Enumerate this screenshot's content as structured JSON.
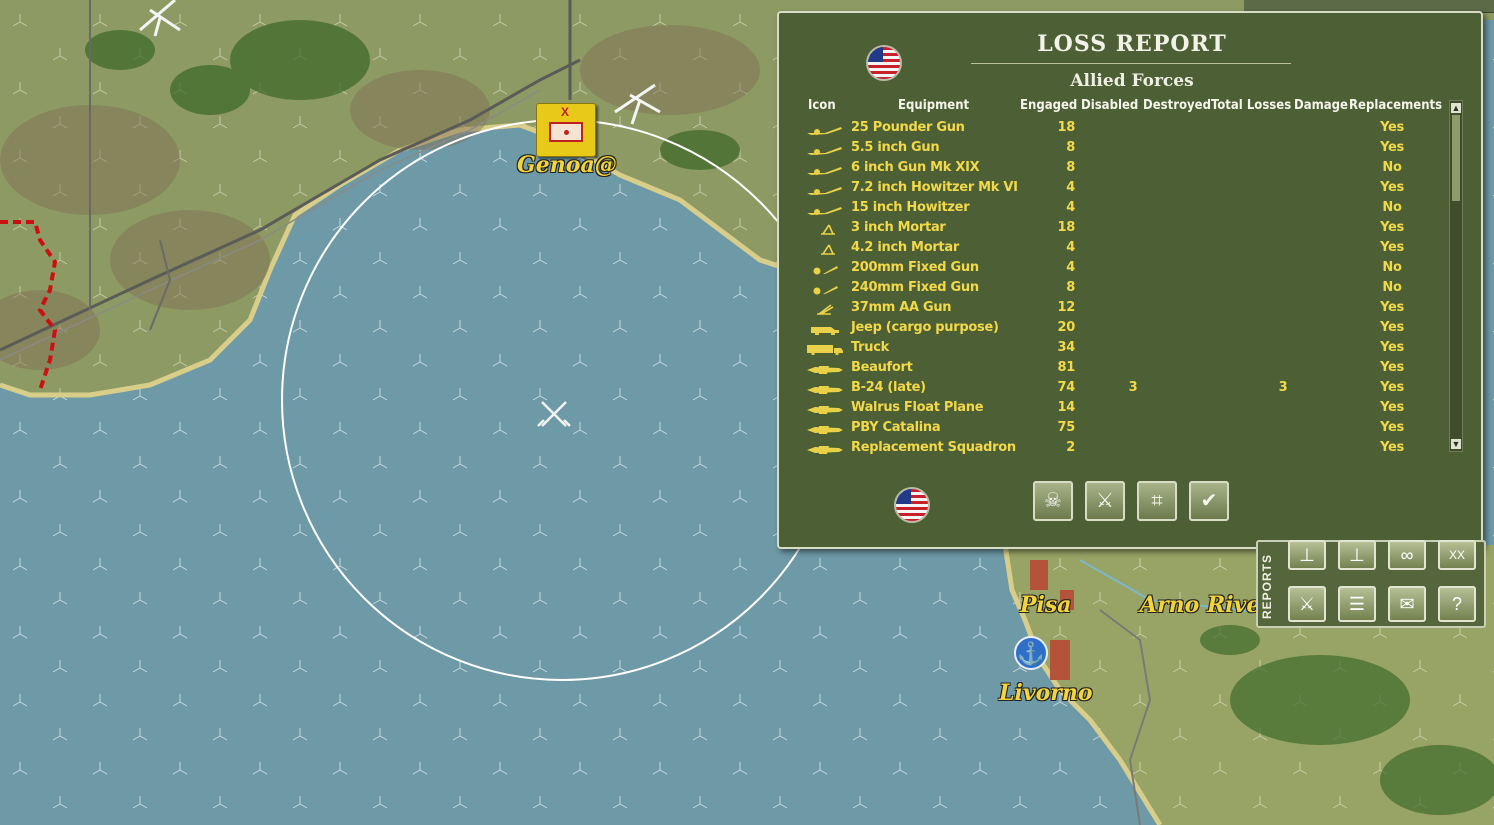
{
  "map": {
    "cities": {
      "genoa": "Genoa@",
      "pisa": "Pisa",
      "arno_river": "Arno Rive",
      "livorno": "Livorno"
    },
    "unit_counter_symbol": "X",
    "icons": [
      "airfield-icon",
      "port-anchor-icon",
      "battle-crossed-swords-icon"
    ]
  },
  "loss_report": {
    "title": "LOSS REPORT",
    "side": "Allied Forces",
    "columns": [
      "Icon",
      "Equipment",
      "Engaged",
      "Disabled",
      "Destroyed",
      "Total Losses",
      "Damage",
      "Replacements"
    ],
    "rows": [
      {
        "icon": "artillery-icon",
        "equipment": "25 Pounder Gun",
        "engaged": "18",
        "disabled": "",
        "total": "",
        "replacements": "Yes"
      },
      {
        "icon": "artillery-icon",
        "equipment": "5.5 inch Gun",
        "engaged": "8",
        "disabled": "",
        "total": "",
        "replacements": "Yes"
      },
      {
        "icon": "artillery-icon",
        "equipment": "6 inch Gun Mk XIX",
        "engaged": "8",
        "disabled": "",
        "total": "",
        "replacements": "No"
      },
      {
        "icon": "artillery-icon",
        "equipment": "7.2 inch Howitzer Mk VI",
        "engaged": "4",
        "disabled": "",
        "total": "",
        "replacements": "Yes"
      },
      {
        "icon": "artillery-icon",
        "equipment": "15 inch Howitzer",
        "engaged": "4",
        "disabled": "",
        "total": "",
        "replacements": "No"
      },
      {
        "icon": "mortar-icon",
        "equipment": "3 inch Mortar",
        "engaged": "18",
        "disabled": "",
        "total": "",
        "replacements": "Yes"
      },
      {
        "icon": "mortar-icon",
        "equipment": "4.2 inch Mortar",
        "engaged": "4",
        "disabled": "",
        "total": "",
        "replacements": "Yes"
      },
      {
        "icon": "fixed-gun-icon",
        "equipment": "200mm Fixed Gun",
        "engaged": "4",
        "disabled": "",
        "total": "",
        "replacements": "No"
      },
      {
        "icon": "fixed-gun-icon",
        "equipment": "240mm Fixed Gun",
        "engaged": "8",
        "disabled": "",
        "total": "",
        "replacements": "No"
      },
      {
        "icon": "aa-gun-icon",
        "equipment": "37mm AA Gun",
        "engaged": "12",
        "disabled": "",
        "total": "",
        "replacements": "Yes"
      },
      {
        "icon": "jeep-icon",
        "equipment": "Jeep (cargo purpose)",
        "engaged": "20",
        "disabled": "",
        "total": "",
        "replacements": "Yes"
      },
      {
        "icon": "truck-icon",
        "equipment": "Truck",
        "engaged": "34",
        "disabled": "",
        "total": "",
        "replacements": "Yes"
      },
      {
        "icon": "aircraft-icon",
        "equipment": "Beaufort",
        "engaged": "81",
        "disabled": "",
        "total": "",
        "replacements": "Yes"
      },
      {
        "icon": "aircraft-icon",
        "equipment": "B-24 (late)",
        "engaged": "74",
        "disabled": "3",
        "total": "3",
        "replacements": "Yes"
      },
      {
        "icon": "aircraft-icon",
        "equipment": "Walrus Float Plane",
        "engaged": "14",
        "disabled": "",
        "total": "",
        "replacements": "Yes"
      },
      {
        "icon": "aircraft-icon",
        "equipment": "PBY Catalina",
        "engaged": "75",
        "disabled": "",
        "total": "",
        "replacements": "Yes"
      },
      {
        "icon": "aircraft-icon",
        "equipment": "Replacement Squadron",
        "engaged": "2",
        "disabled": "",
        "total": "",
        "replacements": "Yes"
      }
    ],
    "buttons": [
      {
        "name": "casualties-button",
        "icon": "shield-skull-icon"
      },
      {
        "name": "combat-units-button",
        "icon": "crossed-swords-icon"
      },
      {
        "name": "map-grid-button",
        "icon": "grid-swords-icon"
      },
      {
        "name": "confirm-button",
        "icon": "checkmark-icon"
      }
    ]
  },
  "reports_panel": {
    "tab_label": "REPORTS",
    "buttons": [
      "org-chart-icon",
      "org-chart-2-icon",
      "infinity-icon",
      "xx-icon",
      "combat-icon",
      "strength-icon",
      "message-icon",
      "help-icon"
    ],
    "xx_label": "XX",
    "help_label": "?"
  },
  "colors": {
    "panel": "#4d5f35",
    "value_text": "#f2d94a",
    "sea": "#6f9aa6",
    "land": "#9aa36a",
    "city_label": "#f3d43a"
  }
}
